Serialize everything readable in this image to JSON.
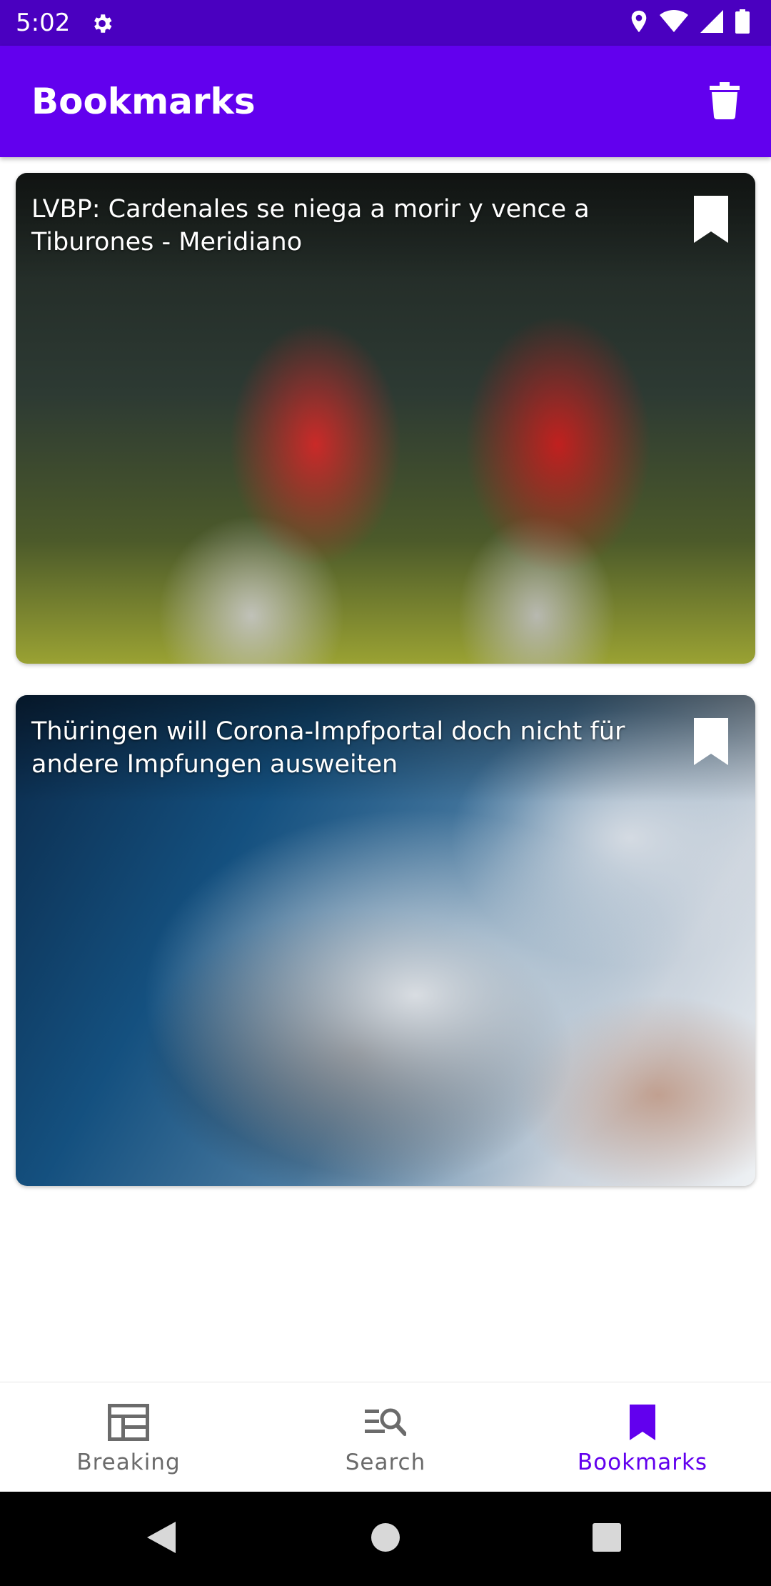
{
  "status_bar": {
    "time": "5:02",
    "icons": [
      "settings-icon",
      "location-icon",
      "wifi-icon",
      "signal-icon",
      "battery-icon"
    ],
    "background": "#4a00c0"
  },
  "app_bar": {
    "title": "Bookmarks",
    "action_icon": "delete-icon",
    "background": "#6200ee"
  },
  "articles": [
    {
      "title": "LVBP: Cardenales se niega a morir y vence a Tiburones - Meridiano",
      "bookmark_icon": "bookmark-icon",
      "bookmarked": true
    },
    {
      "title": "Thüringen will Corona-Impfportal doch nicht für andere Impfungen ausweiten",
      "bookmark_icon": "bookmark-icon",
      "bookmarked": true
    }
  ],
  "bottom_nav": {
    "items": [
      {
        "label": "Breaking",
        "icon": "newspaper-icon",
        "active": false
      },
      {
        "label": "Search",
        "icon": "search-icon",
        "active": false
      },
      {
        "label": "Bookmarks",
        "icon": "bookmark-icon",
        "active": true
      }
    ],
    "active_color": "#6200ee",
    "inactive_color": "#6b6b6b"
  },
  "system_nav": {
    "icons": [
      "back-icon",
      "home-icon",
      "recents-icon"
    ]
  }
}
